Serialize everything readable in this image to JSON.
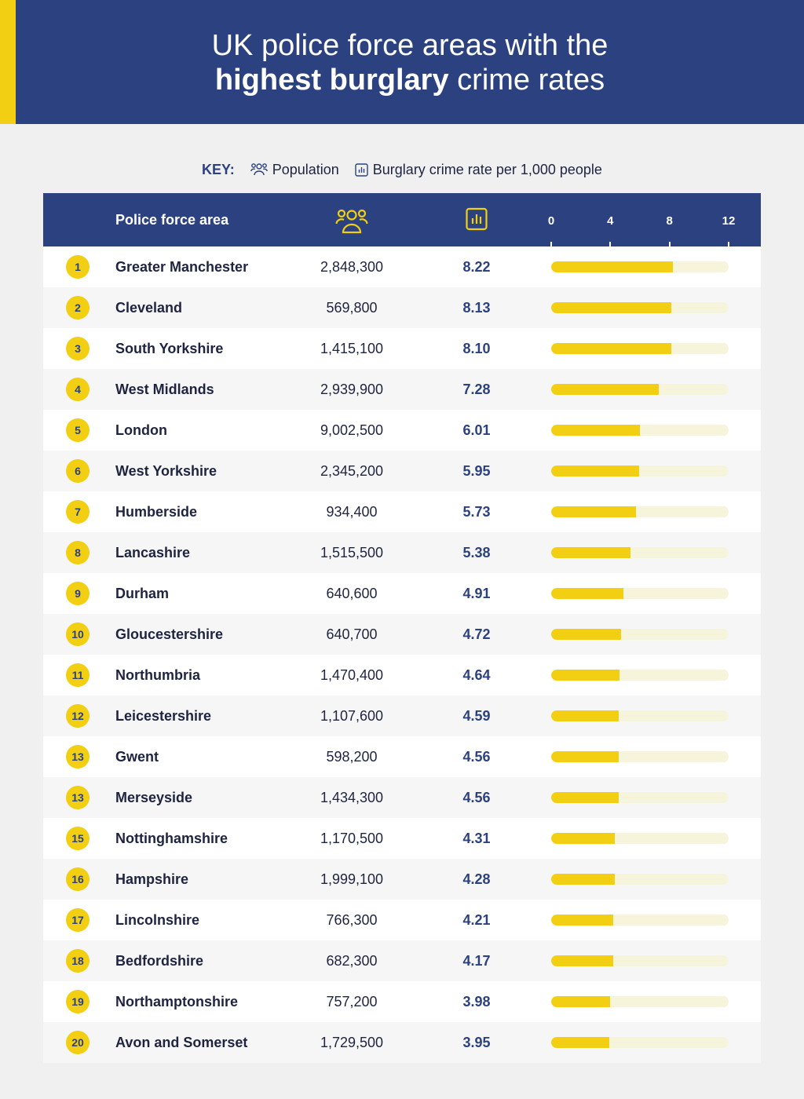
{
  "header": {
    "title_line1": "UK police force areas with the",
    "title_bold": "highest burglary",
    "title_rest": " crime rates"
  },
  "key": {
    "label": "KEY:",
    "population": "Population",
    "rate": "Burglary crime rate per 1,000 people"
  },
  "table": {
    "col_area": "Police force area"
  },
  "colors": {
    "header_bg": "#2c4280",
    "accent": "#f2cf12",
    "bar_track": "#f7f4dc"
  },
  "chart_data": {
    "type": "bar",
    "title": "UK police force areas with the highest burglary crime rates",
    "xlim": [
      0,
      12
    ],
    "ticks": [
      "0",
      "4",
      "8",
      "12"
    ],
    "tick_values": [
      0,
      4,
      8,
      12
    ],
    "rows": [
      {
        "rank": "1",
        "area": "Greater Manchester",
        "population": "2,848,300",
        "rate": "8.22",
        "value": 8.22
      },
      {
        "rank": "2",
        "area": "Cleveland",
        "population": "569,800",
        "rate": "8.13",
        "value": 8.13
      },
      {
        "rank": "3",
        "area": "South Yorkshire",
        "population": "1,415,100",
        "rate": "8.10",
        "value": 8.1
      },
      {
        "rank": "4",
        "area": "West Midlands",
        "population": "2,939,900",
        "rate": "7.28",
        "value": 7.28
      },
      {
        "rank": "5",
        "area": "London",
        "population": "9,002,500",
        "rate": "6.01",
        "value": 6.01
      },
      {
        "rank": "6",
        "area": "West Yorkshire",
        "population": "2,345,200",
        "rate": "5.95",
        "value": 5.95
      },
      {
        "rank": "7",
        "area": "Humberside",
        "population": "934,400",
        "rate": "5.73",
        "value": 5.73
      },
      {
        "rank": "8",
        "area": "Lancashire",
        "population": "1,515,500",
        "rate": "5.38",
        "value": 5.38
      },
      {
        "rank": "9",
        "area": "Durham",
        "population": "640,600",
        "rate": "4.91",
        "value": 4.91
      },
      {
        "rank": "10",
        "area": "Gloucestershire",
        "population": "640,700",
        "rate": "4.72",
        "value": 4.72
      },
      {
        "rank": "11",
        "area": "Northumbria",
        "population": "1,470,400",
        "rate": "4.64",
        "value": 4.64
      },
      {
        "rank": "12",
        "area": "Leicestershire",
        "population": "1,107,600",
        "rate": "4.59",
        "value": 4.59
      },
      {
        "rank": "13",
        "area": "Gwent",
        "population": "598,200",
        "rate": "4.56",
        "value": 4.56
      },
      {
        "rank": "13",
        "area": "Merseyside",
        "population": "1,434,300",
        "rate": "4.56",
        "value": 4.56
      },
      {
        "rank": "15",
        "area": "Nottinghamshire",
        "population": "1,170,500",
        "rate": "4.31",
        "value": 4.31
      },
      {
        "rank": "16",
        "area": "Hampshire",
        "population": "1,999,100",
        "rate": "4.28",
        "value": 4.28
      },
      {
        "rank": "17",
        "area": "Lincolnshire",
        "population": "766,300",
        "rate": "4.21",
        "value": 4.21
      },
      {
        "rank": "18",
        "area": "Bedfordshire",
        "population": "682,300",
        "rate": "4.17",
        "value": 4.17
      },
      {
        "rank": "19",
        "area": "Northamptonshire",
        "population": "757,200",
        "rate": "3.98",
        "value": 3.98
      },
      {
        "rank": "20",
        "area": "Avon and Somerset",
        "population": "1,729,500",
        "rate": "3.95",
        "value": 3.95
      }
    ]
  }
}
